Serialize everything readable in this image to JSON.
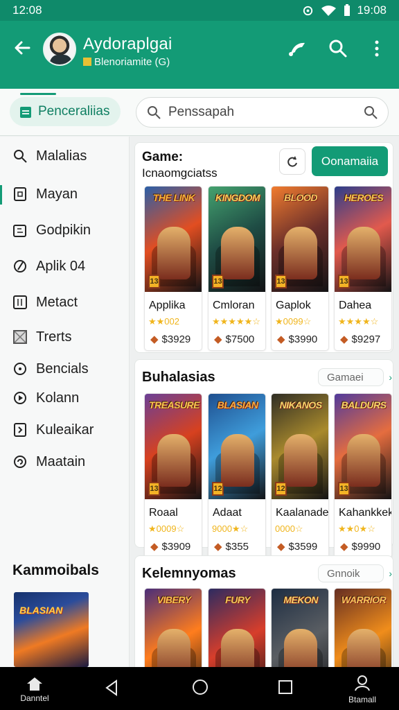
{
  "status": {
    "time_left": "12:08",
    "time_right": "19:08"
  },
  "header": {
    "title": "Aydoraplgai",
    "subtitle": "Blenoriamite (G)"
  },
  "tabs": {
    "active": "Penceraliias",
    "search_placeholder": "Penssapah"
  },
  "sidebar": {
    "items": [
      {
        "label": "Malalias",
        "icon": "search-icon"
      },
      {
        "label": "Mayan",
        "icon": "home-square-icon"
      },
      {
        "label": "Godpikin",
        "icon": "puzzle-icon"
      },
      {
        "label": "Aplik 04",
        "icon": "slash-icon"
      },
      {
        "label": "Metact",
        "icon": "box-11-icon"
      },
      {
        "label": "Trerts",
        "icon": "image-icon"
      },
      {
        "label": "Bencials",
        "icon": "circle-icon"
      },
      {
        "label": "Kolann",
        "icon": "circle-play-icon"
      },
      {
        "label": "Kuleaikar",
        "icon": "square-note-icon"
      },
      {
        "label": "Maatain",
        "icon": "refresh-icon"
      }
    ],
    "featured_heading": "Kammoibals",
    "featured_tile_art": "BLASIAN"
  },
  "section1": {
    "label": "Game:",
    "sub": "Icnaomgciatss",
    "action": "Oonamaiia",
    "cards": [
      {
        "title_art": "THE LINK",
        "name": "Applika",
        "stars": "★★002",
        "price": "$3929",
        "rating": "13",
        "colors": [
          "#2b5fa8",
          "#e24e21",
          "#f4b63c"
        ]
      },
      {
        "title_art": "KINGDOM",
        "name": "Cmloran",
        "stars": "★★★★★☆",
        "price": "$7500",
        "rating": "13",
        "colors": [
          "#44a26f",
          "#1f4d45",
          "#f3d35a"
        ]
      },
      {
        "title_art": "BLOOD",
        "name": "Gaplok",
        "stars": "★0099☆",
        "price": "$3990",
        "rating": "13",
        "colors": [
          "#f17c2f",
          "#6b2f2a",
          "#f6c55d"
        ]
      },
      {
        "title_art": "HEROES",
        "name": "Dahea",
        "stars": "★★★★☆",
        "price": "$9297",
        "rating": "13",
        "colors": [
          "#2c3d8c",
          "#e25a4d",
          "#f2c751"
        ]
      }
    ]
  },
  "section2": {
    "title": "Buhalasias",
    "pill": "Gamaei",
    "cards": [
      {
        "title_art": "TREASURE",
        "name": "Roaal",
        "stars": "★0009☆",
        "price": "$3909",
        "rating": "13",
        "colors": [
          "#6b4096",
          "#d7411f",
          "#f2c751"
        ]
      },
      {
        "title_art": "BLASIAN",
        "name": "Adaat",
        "stars": "9000★☆",
        "price": "$355",
        "rating": "12",
        "colors": [
          "#1f4f8f",
          "#3f9ddb",
          "#f7b145"
        ]
      },
      {
        "title_art": "NIKANOS",
        "name": "Kaalanadem",
        "stars": "0000☆",
        "price": "$3599",
        "rating": "12",
        "colors": [
          "#2f2d24",
          "#a98a2d",
          "#f2d86b"
        ]
      },
      {
        "title_art": "BALDURS",
        "name": "Kahankkek",
        "stars": "★★0★☆",
        "price": "$9990",
        "rating": "13",
        "colors": [
          "#513a9c",
          "#e56d3f",
          "#f5d66c"
        ]
      }
    ]
  },
  "section3": {
    "title": "Kelemnyomas",
    "pill": "Gnnoik",
    "cards": [
      {
        "title_art": "VIBERY",
        "colors": [
          "#4a2d79",
          "#ff7d1d",
          "#f7c14f"
        ]
      },
      {
        "title_art": "FURY",
        "colors": [
          "#2d2b61",
          "#d73e2b",
          "#f0c65c"
        ]
      },
      {
        "title_art": "MEKON",
        "colors": [
          "#1d2d42",
          "#5a5e63",
          "#f4d06a"
        ]
      },
      {
        "title_art": "WARRIOR",
        "colors": [
          "#652e22",
          "#f08d1b",
          "#f7c45a"
        ]
      }
    ]
  },
  "navbar": {
    "left_label": "Danntel",
    "right_label": "Btamall"
  }
}
